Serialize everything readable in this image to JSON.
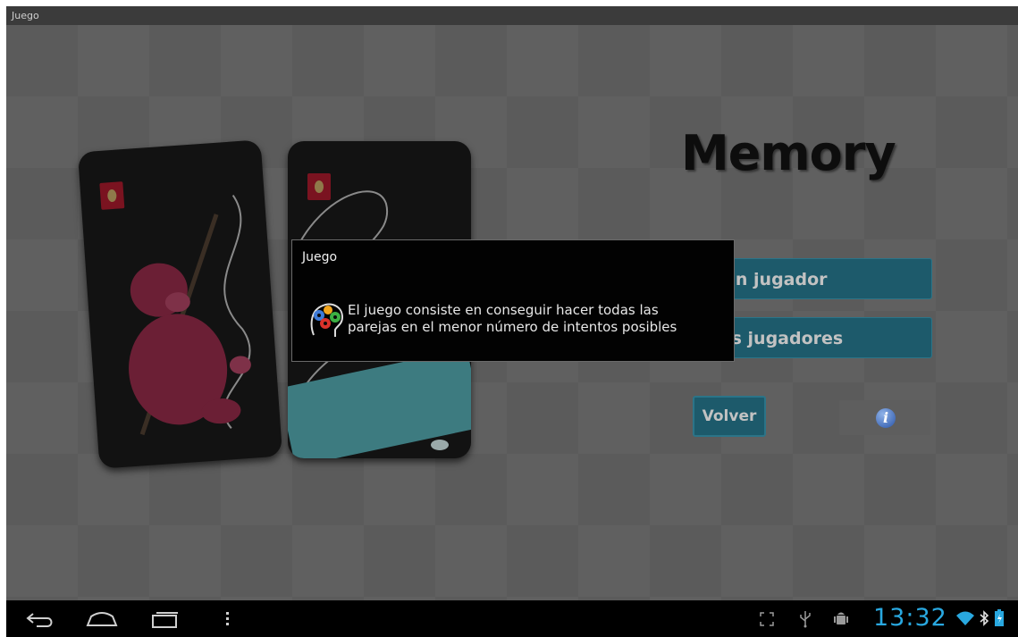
{
  "window": {
    "title": "Juego"
  },
  "app": {
    "title": "Memory",
    "buttons": {
      "one_player": "Un jugador",
      "two_players": "Dos jugadores",
      "back": "Volver",
      "info_glyph": "i"
    }
  },
  "dialog": {
    "title": "Juego",
    "message_line1": "El juego consiste en conseguir hacer todas las",
    "message_line2": "parejas en el menor número de intentos posibles",
    "icon": "brain-gears-icon"
  },
  "system_bar": {
    "time": "13:32",
    "icons": [
      "back-icon",
      "home-icon",
      "recent-apps-icon",
      "menu-icon",
      "fullscreen-icon",
      "usb-icon",
      "android-debug-icon",
      "wifi-icon",
      "bluetooth-icon",
      "battery-icon"
    ],
    "accent_color": "#29a8e0"
  },
  "colors": {
    "button_fill": "#1d5a6b",
    "dialog_bg": "#020202"
  }
}
